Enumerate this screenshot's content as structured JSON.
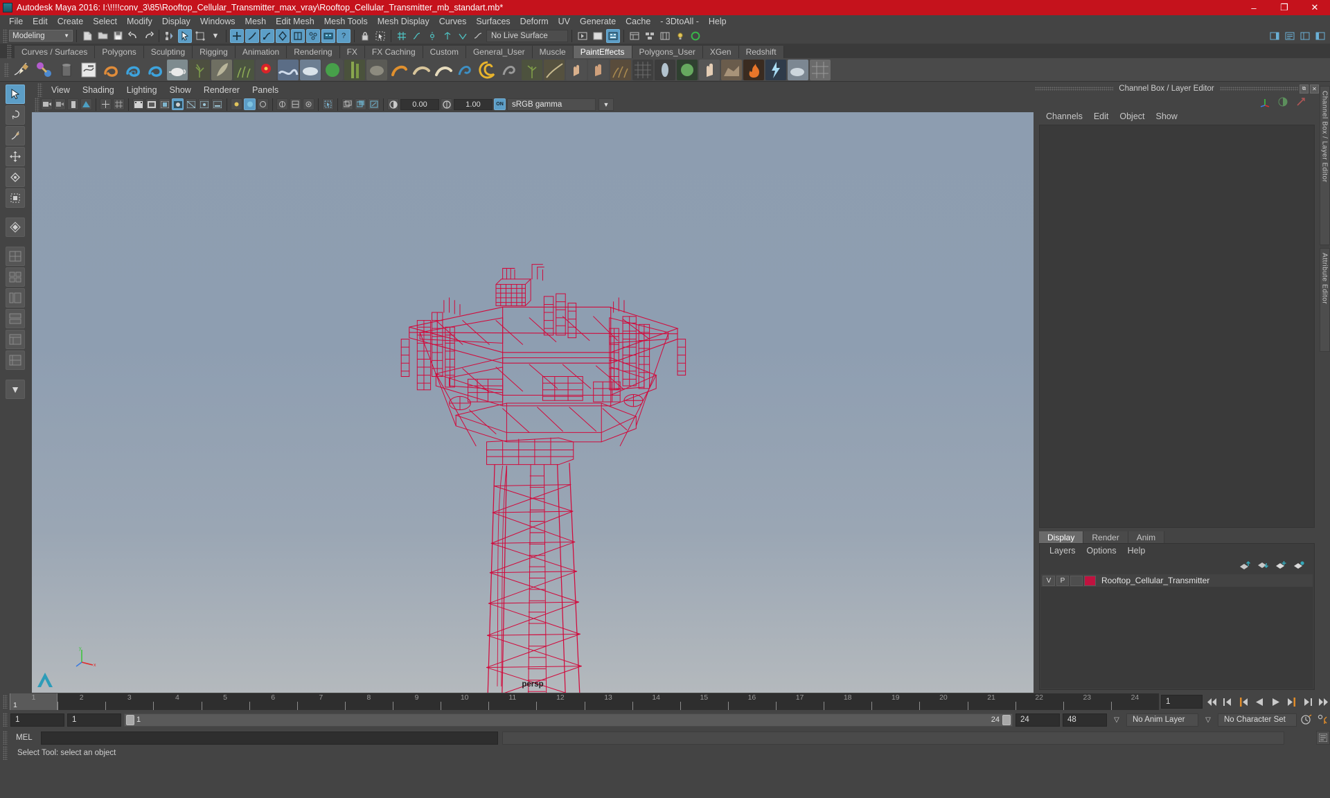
{
  "window": {
    "title": "Autodesk Maya 2016: I:\\!!!!conv_3\\85\\Rooftop_Cellular_Transmitter_max_vray\\Rooftop_Cellular_Transmitter_mb_standart.mb*",
    "minimize": "–",
    "maximize": "❐",
    "close": "✕"
  },
  "menubar": {
    "items": [
      "File",
      "Edit",
      "Create",
      "Select",
      "Modify",
      "Display",
      "Windows",
      "Mesh",
      "Edit Mesh",
      "Mesh Tools",
      "Mesh Display",
      "Curves",
      "Surfaces",
      "Deform",
      "UV",
      "Generate",
      "Cache",
      "- 3DtoAll -",
      "Help"
    ]
  },
  "statusline": {
    "menuset": "Modeling",
    "live_surface": "No Live Surface"
  },
  "shelf": {
    "tabs": [
      "Curves / Surfaces",
      "Polygons",
      "Sculpting",
      "Rigging",
      "Animation",
      "Rendering",
      "FX",
      "FX Caching",
      "Custom",
      "General_User",
      "Muscle",
      "PaintEffects",
      "Polygons_User",
      "XGen",
      "Redshift"
    ],
    "active_tab": "PaintEffects"
  },
  "viewport": {
    "menus": [
      "View",
      "Shading",
      "Lighting",
      "Show",
      "Renderer",
      "Panels"
    ],
    "exposure": "0.00",
    "gamma_value": "1.00",
    "color_profile": "sRGB gamma",
    "camera_label": "persp",
    "model_color": "#d10a3c",
    "bg_top": "#8d9db0",
    "bg_bottom": "#b5bbbf"
  },
  "channel_box": {
    "panel_title": "Channel Box / Layer Editor",
    "menus": [
      "Channels",
      "Edit",
      "Object",
      "Show"
    ]
  },
  "layer_editor": {
    "tabs": [
      "Display",
      "Render",
      "Anim"
    ],
    "active_tab": "Display",
    "menus": [
      "Layers",
      "Options",
      "Help"
    ],
    "layers": [
      {
        "visibility": "V",
        "playback": "P",
        "shade": "",
        "color": "#c0123f",
        "name": "Rooftop_Cellular_Transmitter"
      }
    ]
  },
  "side_tabs": [
    "Channel Box / Layer Editor",
    "Attribute Editor"
  ],
  "timeline": {
    "ticks": [
      1,
      2,
      3,
      4,
      5,
      6,
      7,
      8,
      9,
      10,
      11,
      12,
      13,
      14,
      15,
      16,
      17,
      18,
      19,
      20,
      21,
      22,
      23,
      24
    ],
    "current_frame": "1",
    "current_frame_field": "1",
    "playback_buttons": [
      "go-to-start",
      "step-back-key",
      "step-back-frame",
      "play-backwards",
      "play-forwards",
      "step-forward-frame",
      "step-forward-key",
      "go-to-end"
    ]
  },
  "range": {
    "start": "1",
    "start_visible": "1",
    "range_start_label": "1",
    "range_end_label": "24",
    "playback_end": "24",
    "anim_end": "48",
    "anim_layer": "No Anim Layer",
    "character_set": "No Character Set"
  },
  "command_line": {
    "language": "MEL",
    "input_value": "",
    "output_value": ""
  },
  "status_bar": {
    "message": "Select Tool: select an object"
  }
}
